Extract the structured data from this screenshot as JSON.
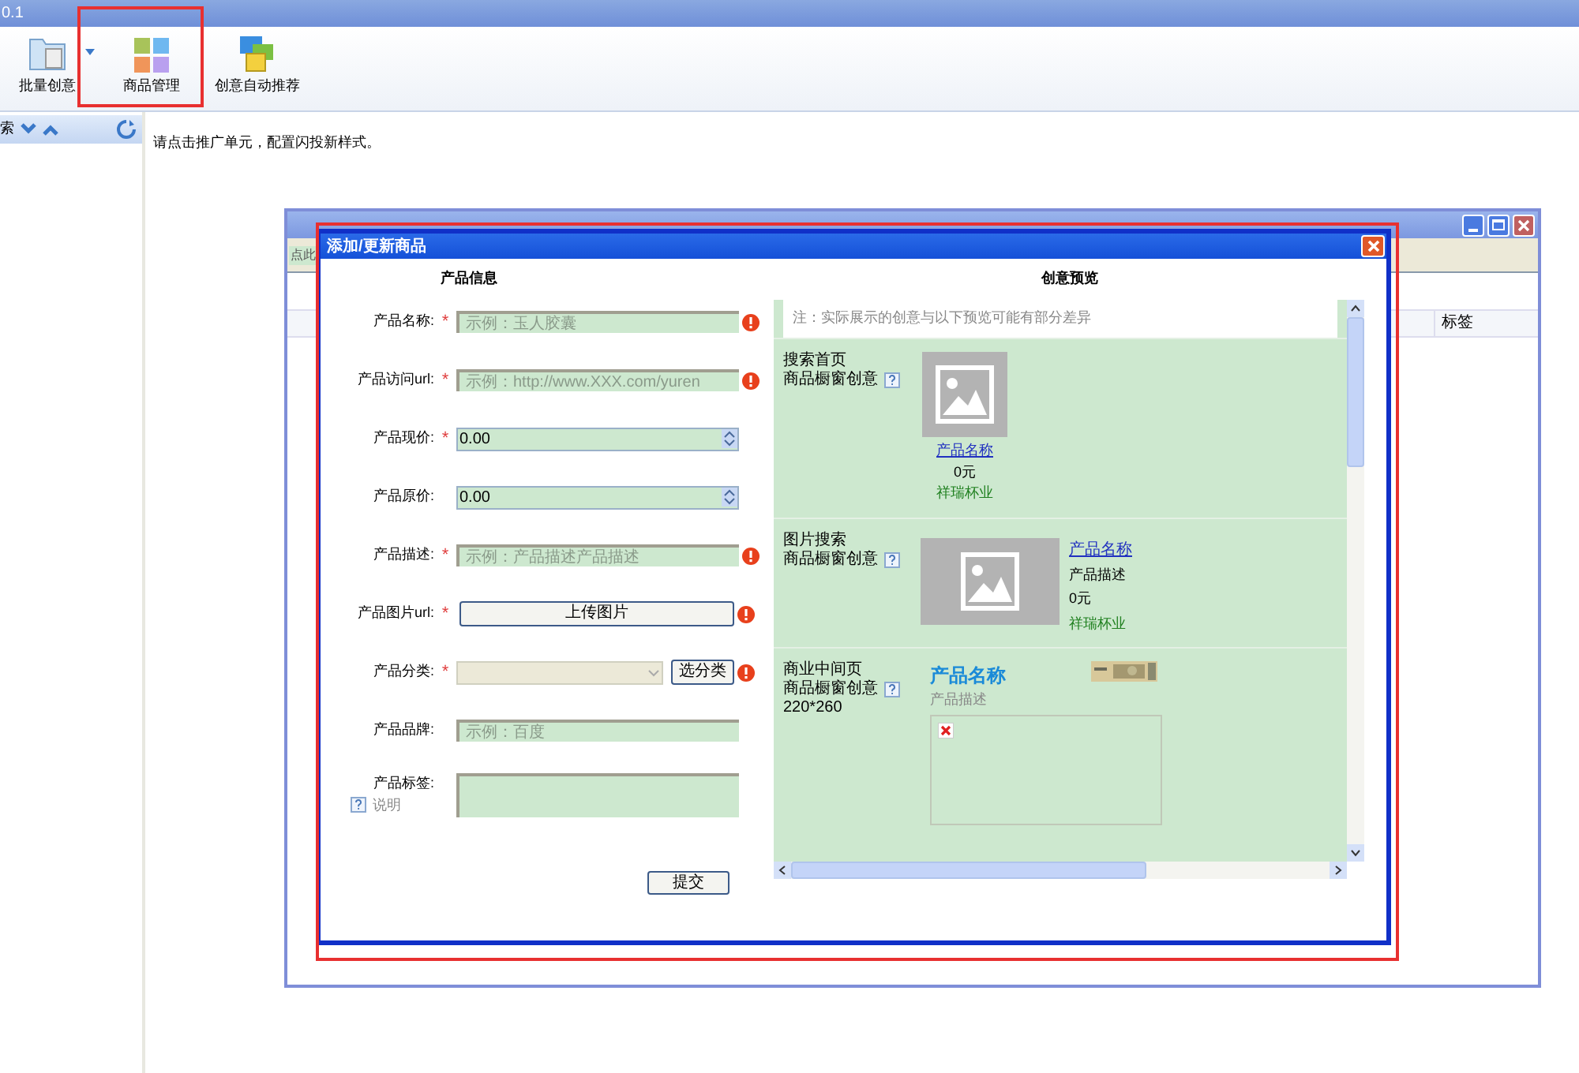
{
  "app": {
    "title": "0.1"
  },
  "toolbar": [
    {
      "label": "批量创意",
      "kind": "folder",
      "dropdown": true
    },
    {
      "label": "商品管理",
      "kind": "grid",
      "dropdown": false
    },
    {
      "label": "创意自动推荐",
      "kind": "windows",
      "dropdown": false
    }
  ],
  "left_panel": {
    "header": "索"
  },
  "content": {
    "message": "请点击推广单元，配置闪投新样式。"
  },
  "background_window": {
    "toolbar_text": "点此",
    "columns": [
      "标签"
    ]
  },
  "dialog": {
    "title": "添加/更新商品",
    "required_mark": "*",
    "form_heading": "产品信息",
    "preview_heading": "创意预览",
    "fields": [
      {
        "label": "产品名称:",
        "kind": "text",
        "required": true,
        "error": true,
        "placeholder": "示例：玉人胶囊"
      },
      {
        "label": "产品访问url:",
        "kind": "text",
        "required": true,
        "error": true,
        "placeholder": "示例：http://www.XXX.com/yuren"
      },
      {
        "label": "产品现价:",
        "kind": "number",
        "required": true,
        "error": false,
        "value": "0.00"
      },
      {
        "label": "产品原价:",
        "kind": "number",
        "required": false,
        "error": false,
        "value": "0.00"
      },
      {
        "label": "产品描述:",
        "kind": "text",
        "required": true,
        "error": true,
        "placeholder": "示例：产品描述产品描述"
      },
      {
        "label": "产品图片url:",
        "kind": "upload",
        "required": true,
        "error": true,
        "button": "上传图片"
      },
      {
        "label": "产品分类:",
        "kind": "select",
        "required": true,
        "error": true,
        "button": "选分类"
      },
      {
        "label": "产品品牌:",
        "kind": "text",
        "required": false,
        "error": false,
        "placeholder": "示例：百度"
      },
      {
        "label": "产品标签:",
        "kind": "textarea",
        "required": false,
        "error": false,
        "help": "说明"
      }
    ],
    "submit": "提交",
    "preview": {
      "note": "注：实际展示的创意与以下预览可能有部分差异",
      "sections": [
        {
          "kind": "search_home",
          "title": [
            "搜索首页",
            "商品橱窗创意"
          ],
          "name": "产品名称",
          "price": "0元",
          "shop": "祥瑞杯业"
        },
        {
          "kind": "image_search",
          "title": [
            "图片搜索",
            "商品橱窗创意"
          ],
          "name": "产品名称",
          "description": "产品描述",
          "price": "0元",
          "shop": "祥瑞杯业"
        },
        {
          "kind": "middle_page",
          "title": [
            "商业中间页",
            "商品橱窗创意",
            "220*260"
          ],
          "name": "产品名称",
          "description": "产品描述"
        }
      ]
    }
  }
}
